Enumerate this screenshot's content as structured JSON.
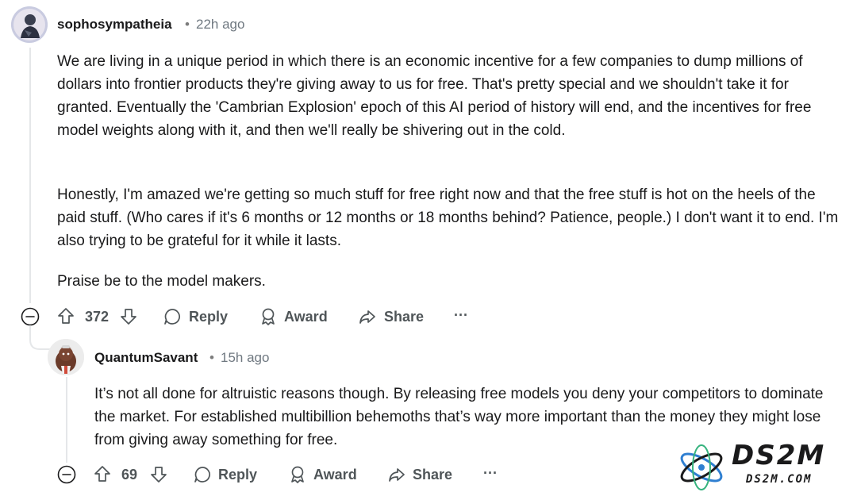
{
  "comments": [
    {
      "username": "sophosympatheia",
      "separator": "•",
      "time": "22h ago",
      "paragraphs": [
        "We are living in a unique period in which there is an economic incentive for a few companies to dump millions of dollars into frontier products they're giving away to us for free. That's pretty special and we shouldn't take it for granted. Eventually the 'Cambrian Explosion' epoch of this AI period of history will end, and the incentives for free model weights along with it, and then we'll really be shivering out in the cold.",
        "Honestly, I'm amazed we're getting so much stuff for free right now and that the free stuff is hot on the heels of the paid stuff. (Who cares if it's 6 months or 12 months or 18 months behind? Patience, people.) I don't want it to end. I'm also trying to be grateful for it while it lasts.",
        "Praise be to the model makers."
      ],
      "votes": "372",
      "actions": {
        "reply": "Reply",
        "award": "Award",
        "share": "Share",
        "more": "···"
      }
    },
    {
      "username": "QuantumSavant",
      "separator": "•",
      "time": "15h ago",
      "paragraphs": [
        "It’s not all done for altruistic reasons though. By releasing free models you deny your competitors to dominate the market. For established multibillion behemoths that’s way more important than the money they might lose from giving away something for free."
      ],
      "votes": "69",
      "actions": {
        "reply": "Reply",
        "award": "Award",
        "share": "Share",
        "more": "···"
      }
    }
  ],
  "watermark": {
    "brand": "DS2M",
    "url": "DS2M.COM",
    "colors": {
      "ring": "#2f7fd1",
      "ring2": "#36b37e",
      "text": "#1a1a1b"
    }
  },
  "icons": [
    "collapse-icon",
    "upvote-icon",
    "downvote-icon",
    "comment-bubble-icon",
    "award-icon",
    "share-icon",
    "more-icon"
  ]
}
